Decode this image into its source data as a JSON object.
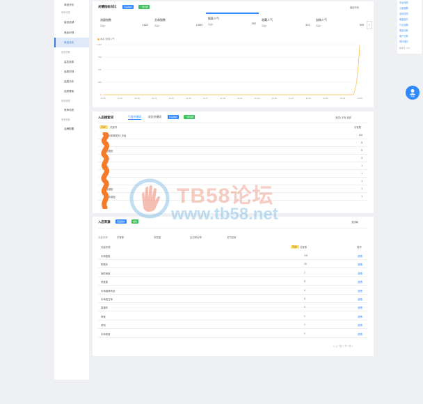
{
  "sidebar": {
    "top_item": "商品分析",
    "groups": [
      {
        "label": "竞争情报",
        "items": [
          "监控店铺",
          "竞品识别",
          "竞品分析"
        ]
      },
      {
        "label": "品类洞察",
        "items": [
          "监控品类",
          "品类识别",
          "品类分析",
          "品类看板"
        ]
      },
      {
        "label": "营销管理",
        "items": [
          "竞争动态"
        ]
      },
      {
        "label": "竞争配置",
        "items": [
          "品牌配置"
        ]
      }
    ],
    "active": "竞品分析"
  },
  "panel1": {
    "title": "关键指标对比",
    "btn1": "竞品指标",
    "btn2": "一键诊断",
    "select": "最近30天",
    "metrics": [
      {
        "label": "流量指数",
        "sub": "竞品1",
        "value": "1,622"
      },
      {
        "label": "交易指数",
        "sub": "竞品1",
        "value": "2,683"
      },
      {
        "label": "搜索人气",
        "sub": "竞品1",
        "value": "982"
      },
      {
        "label": "收藏人气",
        "sub": "竞品1",
        "value": "313"
      },
      {
        "label": "加购人气",
        "sub": "竞品1",
        "value": "509"
      }
    ],
    "legend": "本店 | 搜索人气"
  },
  "chart_data": {
    "type": "line",
    "categories": [
      "11-05",
      "11-07",
      "11-09",
      "11-11",
      "11-13",
      "11-15",
      "11-17",
      "11-19",
      "11-21",
      "11-23",
      "11-25",
      "11-27",
      "11-29",
      "12-01",
      "12-03",
      "12-05"
    ],
    "series": [
      {
        "values": [
          0,
          0,
          0,
          0,
          0,
          0,
          0,
          0,
          0,
          0,
          0,
          0,
          0,
          0,
          0,
          982
        ]
      }
    ],
    "yticks": [
      "1,000",
      "750",
      "500",
      "250",
      "0"
    ],
    "ylim": [
      0,
      1000
    ],
    "color": "#f5c04a",
    "grid": true
  },
  "panel2": {
    "title": "入店搜索词",
    "tabs": [
      "引流关键词",
      "成交关键词"
    ],
    "btn1": "竞品指标",
    "btn2": "一键诊断",
    "controls": "无线 | 手淘  全部",
    "badge": "竞品1",
    "col_keyword": "关键词",
    "col_value": "访客数",
    "rows": [
      {
        "kw": "手办巨型模型3D 手绘",
        "val": "115"
      },
      {
        "kw": "模型",
        "val": "5"
      },
      {
        "kw": "巨型模型",
        "val": "5"
      },
      {
        "kw": "手绘",
        "val": "3"
      },
      {
        "kw": "手办",
        "val": "1"
      },
      {
        "kw": "模型",
        "val": "1"
      },
      {
        "kw": "手办",
        "val": "1"
      },
      {
        "kw": "手绘模型",
        "val": "1"
      },
      {
        "kw": "手办大模型",
        "val": "1"
      }
    ]
  },
  "watermark": {
    "line1": "TB58论坛",
    "line2": "www.tb58.net"
  },
  "panel3": {
    "title": "入店来源",
    "btn1": "竞品指标",
    "btn2": "指标",
    "select": "无线端",
    "filters": [
      "流量来源",
      "访客数",
      "浏览量",
      "支付转化率",
      "支付买家"
    ],
    "col_source": "流量来源",
    "badge": "竞品1",
    "col_metric": "访客数",
    "col_action": "操作",
    "rows": [
      {
        "src": "手淘搜索",
        "val": "141",
        "act": "趋势"
      },
      {
        "src": "购物车",
        "val": "15",
        "act": "趋势"
      },
      {
        "src": "我的淘宝",
        "val": "7",
        "act": "趋势"
      },
      {
        "src": "淘宝客",
        "val": "5",
        "act": "趋势"
      },
      {
        "src": "手淘推荐商品",
        "val": "4",
        "act": "趋势"
      },
      {
        "src": "手淘拍立淘",
        "val": "3",
        "act": "趋势"
      },
      {
        "src": "直通车",
        "val": "2",
        "act": "趋势"
      },
      {
        "src": "淘宝",
        "val": "1",
        "act": "趋势"
      },
      {
        "src": "其他",
        "val": "1",
        "act": "趋势"
      },
      {
        "src": "手淘淘宝",
        "val": "1",
        "act": "趋势"
      }
    ],
    "pagination": "< 上一页  1  下一页 >"
  },
  "right_tools": [
    "平台动态",
    "上新趋势",
    "活动日历",
    "竞品实时",
    "行业月报",
    "类目分析",
    "用户分析",
    "同行排行"
  ],
  "right_version": "版本号: v1.0",
  "fab_label": "问答"
}
